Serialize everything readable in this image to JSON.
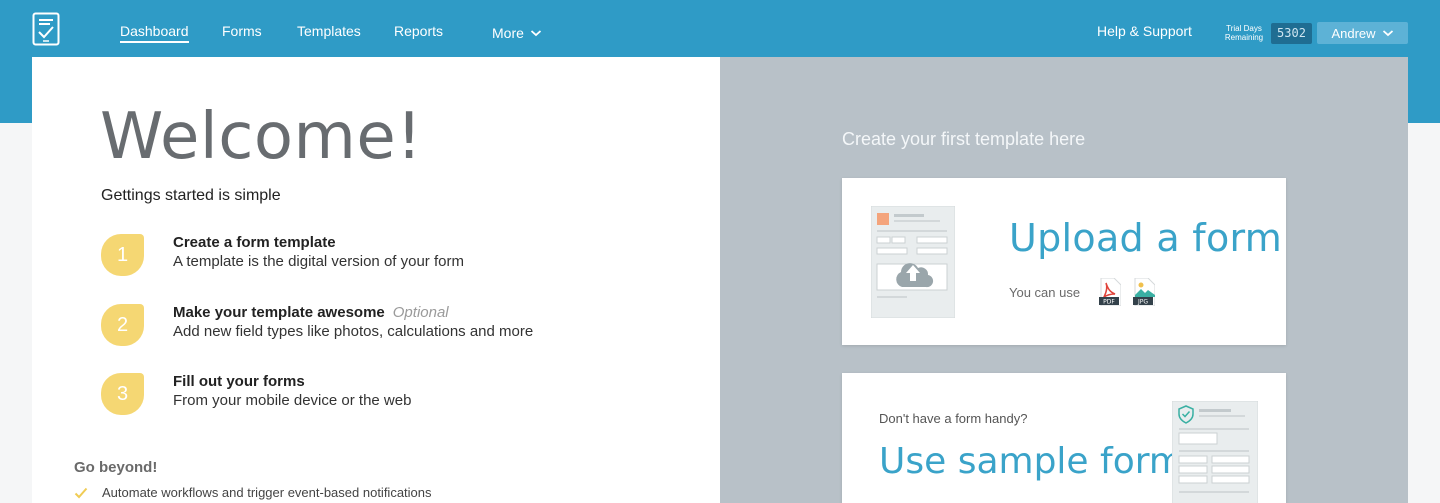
{
  "nav": {
    "links": [
      "Dashboard",
      "Forms",
      "Templates",
      "Reports",
      "More"
    ],
    "help": "Help & Support",
    "trial_label_line1": "Trial Days",
    "trial_label_line2": "Remaining",
    "trial_days": "5302",
    "user": "Andrew"
  },
  "welcome": {
    "title": "Welcome!",
    "subtitle": "Gettings started is simple",
    "steps": [
      {
        "num": "1",
        "title": "Create a form template",
        "optional": "",
        "desc": "A template is the digital version of your form"
      },
      {
        "num": "2",
        "title": "Make your template awesome",
        "optional": "Optional",
        "desc": "Add new field types like photos, calculations and more"
      },
      {
        "num": "3",
        "title": "Fill out your forms",
        "optional": "",
        "desc": "From your mobile device or the web"
      }
    ],
    "beyond_title": "Go beyond!",
    "beyond_items": [
      "Automate workflows and trigger event-based notifications"
    ]
  },
  "right": {
    "heading": "Create your first template here",
    "upload": {
      "title": "Upload a form",
      "you_can_use": "You can use",
      "formats": [
        "PDF",
        "JPG"
      ]
    },
    "sample": {
      "subtitle": "Don't have a form handy?",
      "title": "Use sample form"
    }
  },
  "colors": {
    "brand_blue": "#2f9bc6",
    "accent_teal": "#3aa3c9",
    "step_yellow": "#f5d773",
    "right_panel": "#b8c1c8"
  }
}
